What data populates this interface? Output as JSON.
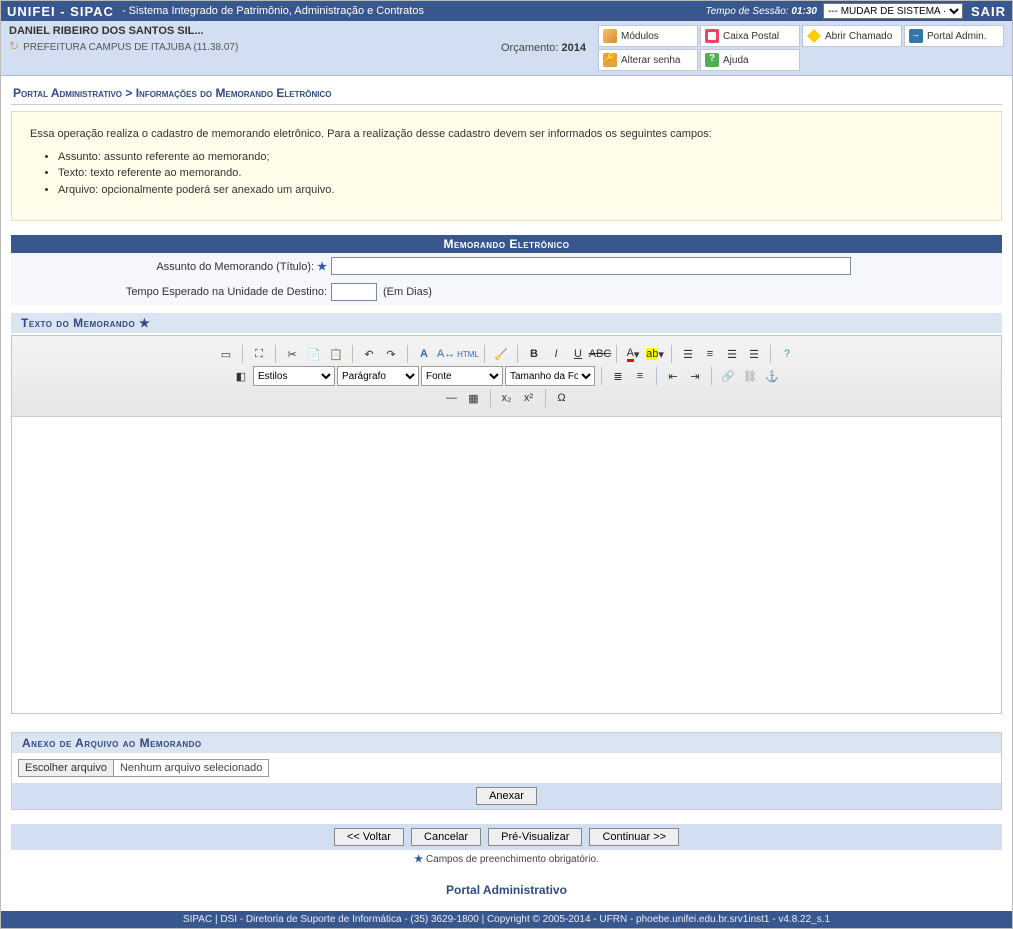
{
  "topbar": {
    "app": "UNIFEI - SIPAC",
    "desc": "- Sistema Integrado de Patrimônio, Administração e Contratos",
    "session_label": "Tempo de Sessão:",
    "session_time": "01:30",
    "system_select": "--- MUDAR DE SISTEMA ·",
    "sair": "SAIR"
  },
  "user": {
    "name": "DANIEL RIBEIRO DOS SANTOS SIL...",
    "unit": "PREFEITURA CAMPUS DE ITAJUBA (11.38.07)",
    "orc_label": "Orçamento:",
    "orc_year": "2014"
  },
  "menu": {
    "modulos": "Módulos",
    "caixa": "Caixa Postal",
    "chamado": "Abrir Chamado",
    "portaladm": "Portal Admin.",
    "senha": "Alterar senha",
    "ajuda": "Ajuda"
  },
  "breadcrumb": "Portal Administrativo > Informações do Memorando Eletrônico",
  "instructions": {
    "intro": "Essa operação realiza o cadastro de memorando eletrônico. Para a realização desse cadastro devem ser informados os seguintes campos:",
    "b1": "Assunto: assunto referente ao memorando;",
    "b2": "Texto: texto referente ao memorando.",
    "b3": "Arquivo: opcionalmente poderá ser anexado um arquivo."
  },
  "form": {
    "section_title": "Memorando Eletrônico",
    "assunto_label": "Assunto do Memorando (Título):",
    "tempo_label": "Tempo Esperado na Unidade de Destino:",
    "tempo_suffix": "(Em Dias)",
    "texto_section": "Texto do Memorando",
    "anexo_section": "Anexo de Arquivo ao Memorando",
    "file_btn": "Escolher arquivo",
    "file_none": "Nenhum arquivo selecionado",
    "anexar": "Anexar",
    "voltar": "<< Voltar",
    "cancelar": "Cancelar",
    "previsualizar": "Pré-Visualizar",
    "continuar": "Continuar >>",
    "req_note": "Campos de preenchimento obrigatório.",
    "portal_link": "Portal Administrativo"
  },
  "editor": {
    "sel_estilos": "Estilos",
    "sel_paragrafo": "Parágrafo",
    "sel_fonte": "Fonte",
    "sel_tamanho": "Tamanho da Fo"
  },
  "footer": "SIPAC | DSI - Diretoria de Suporte de Informática - (35) 3629-1800 | Copyright © 2005-2014 - UFRN - phoebe.unifei.edu.br.srv1inst1 - v4.8.22_s.1"
}
